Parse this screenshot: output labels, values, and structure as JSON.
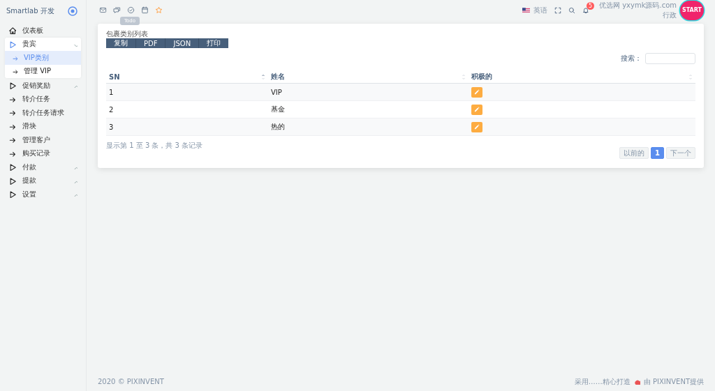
{
  "sidebar": {
    "brand": "Smartlab 开发",
    "items": [
      {
        "kind": "home",
        "label": "仪表板"
      },
      {
        "kind": "group",
        "label": "贵宾",
        "expanded": true,
        "children": [
          {
            "label": "VIP类别",
            "selected": true
          },
          {
            "label": "管理 VIP",
            "selected": false
          }
        ]
      },
      {
        "kind": "group",
        "label": "促销奖励",
        "expanded": false
      },
      {
        "kind": "link",
        "label": "转介任务"
      },
      {
        "kind": "link",
        "label": "转介任务请求"
      },
      {
        "kind": "link",
        "label": "滑块"
      },
      {
        "kind": "link",
        "label": "管理客户"
      },
      {
        "kind": "link",
        "label": "购买记录"
      },
      {
        "kind": "group",
        "label": "付款",
        "expanded": false
      },
      {
        "kind": "group",
        "label": "提款",
        "expanded": false
      },
      {
        "kind": "group",
        "label": "设置",
        "expanded": false
      }
    ]
  },
  "topbar": {
    "tooltip": "Todo",
    "language": "英语",
    "notification_count": "5",
    "user_name": "优选网 yxymk源码.com",
    "user_role": "行政",
    "avatar_text": "START"
  },
  "card": {
    "title": "包裹类别列表",
    "export_buttons": [
      "复制",
      "PDF",
      "JSON",
      "打印"
    ],
    "search_label": "搜索：",
    "columns": [
      {
        "label": "SN",
        "sorted": true
      },
      {
        "label": "姓名",
        "sorted": false
      },
      {
        "label": "积极的",
        "sorted": false
      }
    ],
    "rows": [
      {
        "sn": "1",
        "name": "VIP"
      },
      {
        "sn": "2",
        "name": "基金"
      },
      {
        "sn": "3",
        "name": "热的"
      }
    ],
    "info": "显示第 1 至 3 条，共 3 条记录",
    "pagination": [
      {
        "label": "以前的",
        "selected": false
      },
      {
        "label": "1",
        "selected": true
      },
      {
        "label": "下一个",
        "selected": false
      }
    ]
  },
  "footer": {
    "left": "2020 © PIXINVENT",
    "right_before": "采用……精心打造",
    "right_after": "由 PIXINVENT提供"
  }
}
